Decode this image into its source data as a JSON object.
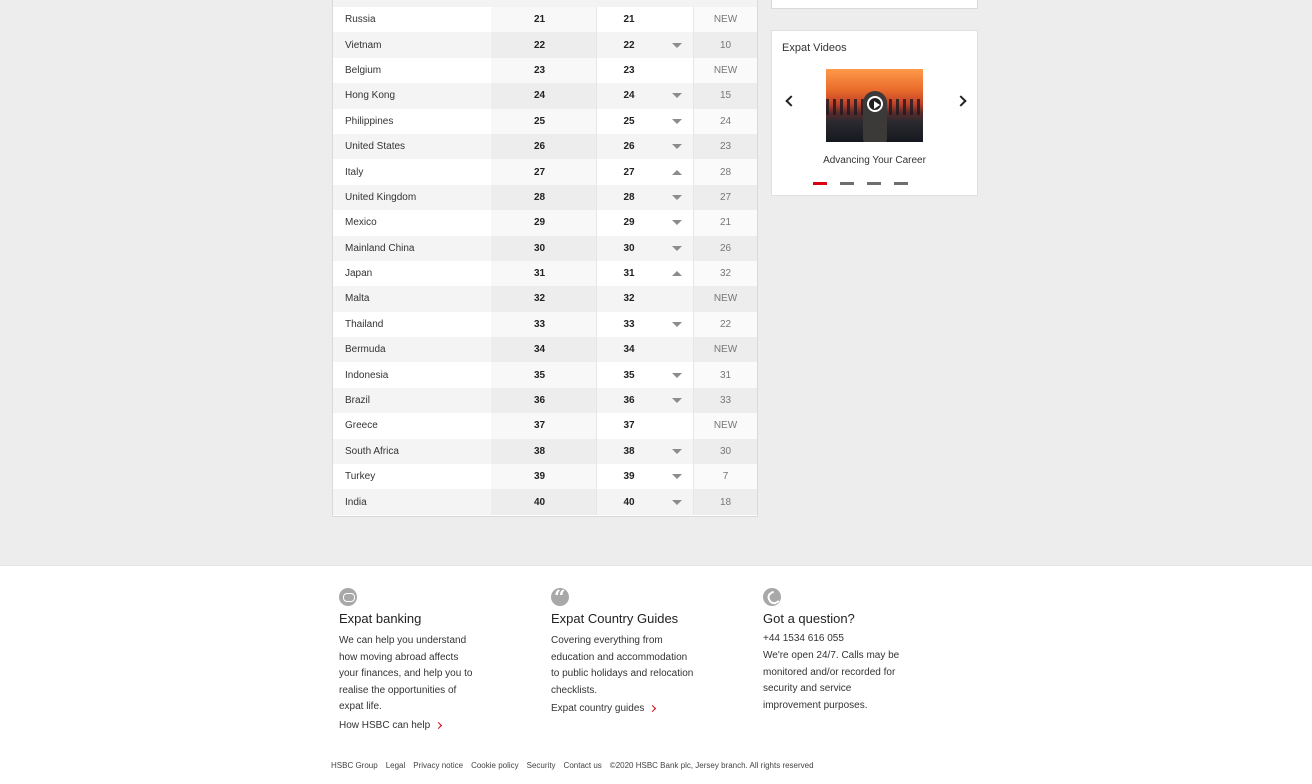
{
  "ranking": {
    "rows": [
      {
        "country": "Russia",
        "rank": "21",
        "rank2": "21",
        "trend": "none",
        "prev": "NEW"
      },
      {
        "country": "Vietnam",
        "rank": "22",
        "rank2": "22",
        "trend": "down",
        "prev": "10"
      },
      {
        "country": "Belgium",
        "rank": "23",
        "rank2": "23",
        "trend": "none",
        "prev": "NEW"
      },
      {
        "country": "Hong Kong",
        "rank": "24",
        "rank2": "24",
        "trend": "down",
        "prev": "15"
      },
      {
        "country": "Philippines",
        "rank": "25",
        "rank2": "25",
        "trend": "down",
        "prev": "24"
      },
      {
        "country": "United States",
        "rank": "26",
        "rank2": "26",
        "trend": "down",
        "prev": "23"
      },
      {
        "country": "Italy",
        "rank": "27",
        "rank2": "27",
        "trend": "up",
        "prev": "28"
      },
      {
        "country": "United Kingdom",
        "rank": "28",
        "rank2": "28",
        "trend": "down",
        "prev": "27"
      },
      {
        "country": "Mexico",
        "rank": "29",
        "rank2": "29",
        "trend": "down",
        "prev": "21"
      },
      {
        "country": "Mainland China",
        "rank": "30",
        "rank2": "30",
        "trend": "down",
        "prev": "26"
      },
      {
        "country": "Japan",
        "rank": "31",
        "rank2": "31",
        "trend": "up",
        "prev": "32"
      },
      {
        "country": "Malta",
        "rank": "32",
        "rank2": "32",
        "trend": "none",
        "prev": "NEW"
      },
      {
        "country": "Thailand",
        "rank": "33",
        "rank2": "33",
        "trend": "down",
        "prev": "22"
      },
      {
        "country": "Bermuda",
        "rank": "34",
        "rank2": "34",
        "trend": "none",
        "prev": "NEW"
      },
      {
        "country": "Indonesia",
        "rank": "35",
        "rank2": "35",
        "trend": "down",
        "prev": "31"
      },
      {
        "country": "Brazil",
        "rank": "36",
        "rank2": "36",
        "trend": "down",
        "prev": "33"
      },
      {
        "country": "Greece",
        "rank": "37",
        "rank2": "37",
        "trend": "none",
        "prev": "NEW"
      },
      {
        "country": "South Africa",
        "rank": "38",
        "rank2": "38",
        "trend": "down",
        "prev": "30"
      },
      {
        "country": "Turkey",
        "rank": "39",
        "rank2": "39",
        "trend": "down",
        "prev": "7"
      },
      {
        "country": "India",
        "rank": "40",
        "rank2": "40",
        "trend": "down",
        "prev": "18"
      }
    ]
  },
  "videos": {
    "title": "Expat Videos",
    "caption": "Advancing Your Career",
    "slide_count": 4,
    "active_slide": 1,
    "accent_color": "#db0011"
  },
  "footer": {
    "banking": {
      "icon": "chat-icon",
      "title": "Expat banking",
      "text": "We can help you understand how moving abroad affects your finances, and help you to realise the opportunities of expat life.",
      "link": "How HSBC can help"
    },
    "guides": {
      "icon": "quote-icon",
      "title": "Expat Country Guides",
      "text": "Covering everything from education and accommodation to public holidays and relocation checklists.",
      "link": "Expat country guides"
    },
    "question": {
      "icon": "phone-icon",
      "title": "Got a question?",
      "phone": "+44 1534 616 055",
      "text": "We're open 24/7. Calls may be monitored and/or recorded for security and service improvement purposes."
    },
    "legal": {
      "links": [
        "HSBC Group",
        "Legal",
        "Privacy notice",
        "Cookie policy",
        "Security",
        "Contact us"
      ],
      "copyright": "©2020 HSBC Bank plc, Jersey branch. All rights reserved"
    }
  }
}
